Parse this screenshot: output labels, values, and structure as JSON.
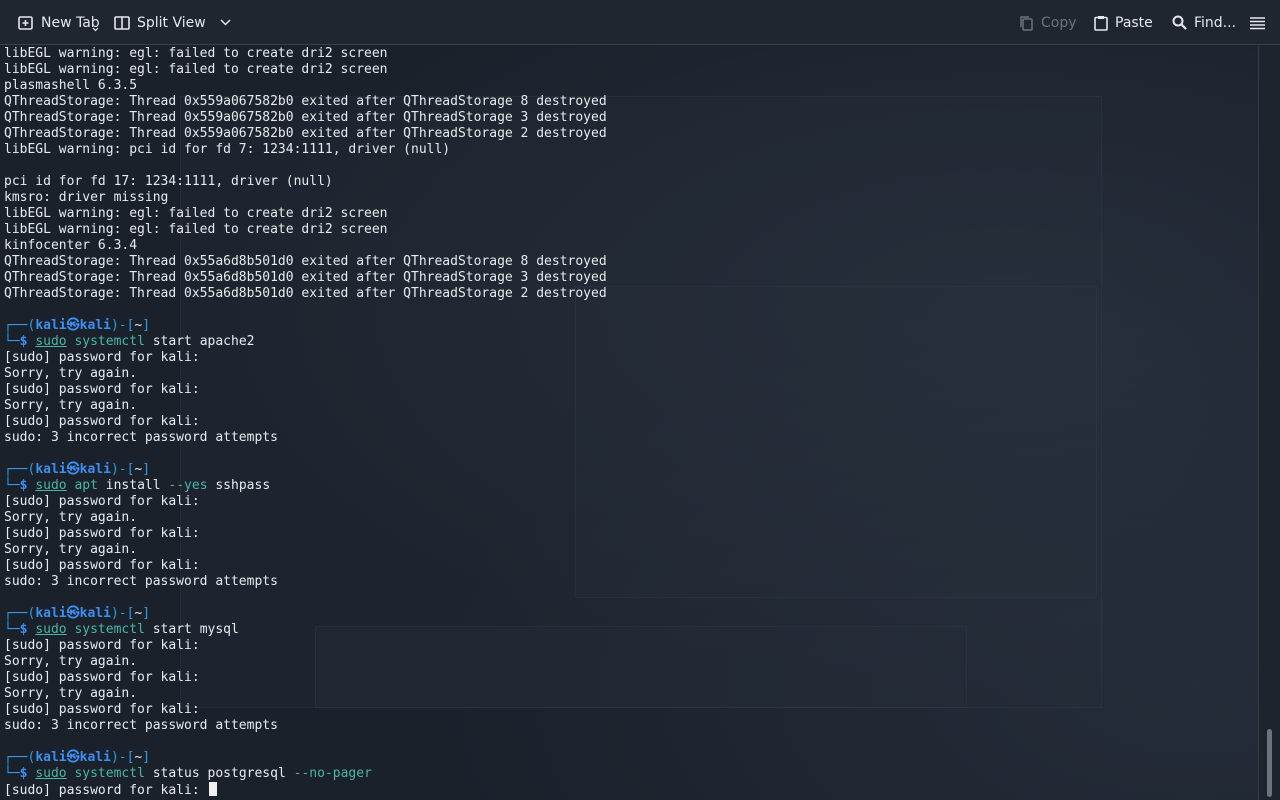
{
  "toolbar": {
    "new_tab": "New Tab",
    "split_view": "Split View",
    "copy": "Copy",
    "paste": "Paste",
    "find": "Find..."
  },
  "prompt": {
    "user": "kali",
    "host": "kali",
    "dir": "~",
    "symbol": "㉿"
  },
  "terminal": {
    "output_block_1": [
      "libEGL warning: egl: failed to create dri2 screen",
      "libEGL warning: egl: failed to create dri2 screen",
      "plasmashell 6.3.5",
      "QThreadStorage: Thread 0x559a067582b0 exited after QThreadStorage 8 destroyed",
      "QThreadStorage: Thread 0x559a067582b0 exited after QThreadStorage 3 destroyed",
      "QThreadStorage: Thread 0x559a067582b0 exited after QThreadStorage 2 destroyed",
      "libEGL warning: pci id for fd 7: 1234:1111, driver (null)",
      "",
      "pci id for fd 17: 1234:1111, driver (null)",
      "kmsro: driver missing",
      "libEGL warning: egl: failed to create dri2 screen",
      "libEGL warning: egl: failed to create dri2 screen",
      "kinfocenter 6.3.4",
      "QThreadStorage: Thread 0x55a6d8b501d0 exited after QThreadStorage 8 destroyed",
      "QThreadStorage: Thread 0x55a6d8b501d0 exited after QThreadStorage 3 destroyed",
      "QThreadStorage: Thread 0x55a6d8b501d0 exited after QThreadStorage 2 destroyed",
      ""
    ],
    "commands": [
      {
        "sudo": "sudo",
        "bin": "systemctl",
        "args": " start apache2",
        "opt": "",
        "output": [
          "[sudo] password for kali:",
          "Sorry, try again.",
          "[sudo] password for kali:",
          "Sorry, try again.",
          "[sudo] password for kali:",
          "sudo: 3 incorrect password attempts",
          ""
        ]
      },
      {
        "sudo": "sudo",
        "bin": "apt",
        "args": " install ",
        "opt": "--yes",
        "tail": " sshpass",
        "output": [
          "[sudo] password for kali:",
          "Sorry, try again.",
          "[sudo] password for kali:",
          "Sorry, try again.",
          "[sudo] password for kali:",
          "sudo: 3 incorrect password attempts",
          ""
        ]
      },
      {
        "sudo": "sudo",
        "bin": "systemctl",
        "args": " start mysql",
        "opt": "",
        "output": [
          "[sudo] password for kali:",
          "Sorry, try again.",
          "[sudo] password for kali:",
          "Sorry, try again.",
          "[sudo] password for kali:",
          "sudo: 3 incorrect password attempts",
          ""
        ]
      },
      {
        "sudo": "sudo",
        "bin": "systemctl",
        "args": " status postgresql ",
        "opt": "--no-pager",
        "output": []
      }
    ],
    "current_line": "[sudo] password for kali: "
  },
  "colors": {
    "background": "#1b212b",
    "toolbar": "#20262f",
    "prompt_frame": "#2e9be4",
    "prompt_user": "#3a8ff2",
    "command": "#48b6a6"
  }
}
